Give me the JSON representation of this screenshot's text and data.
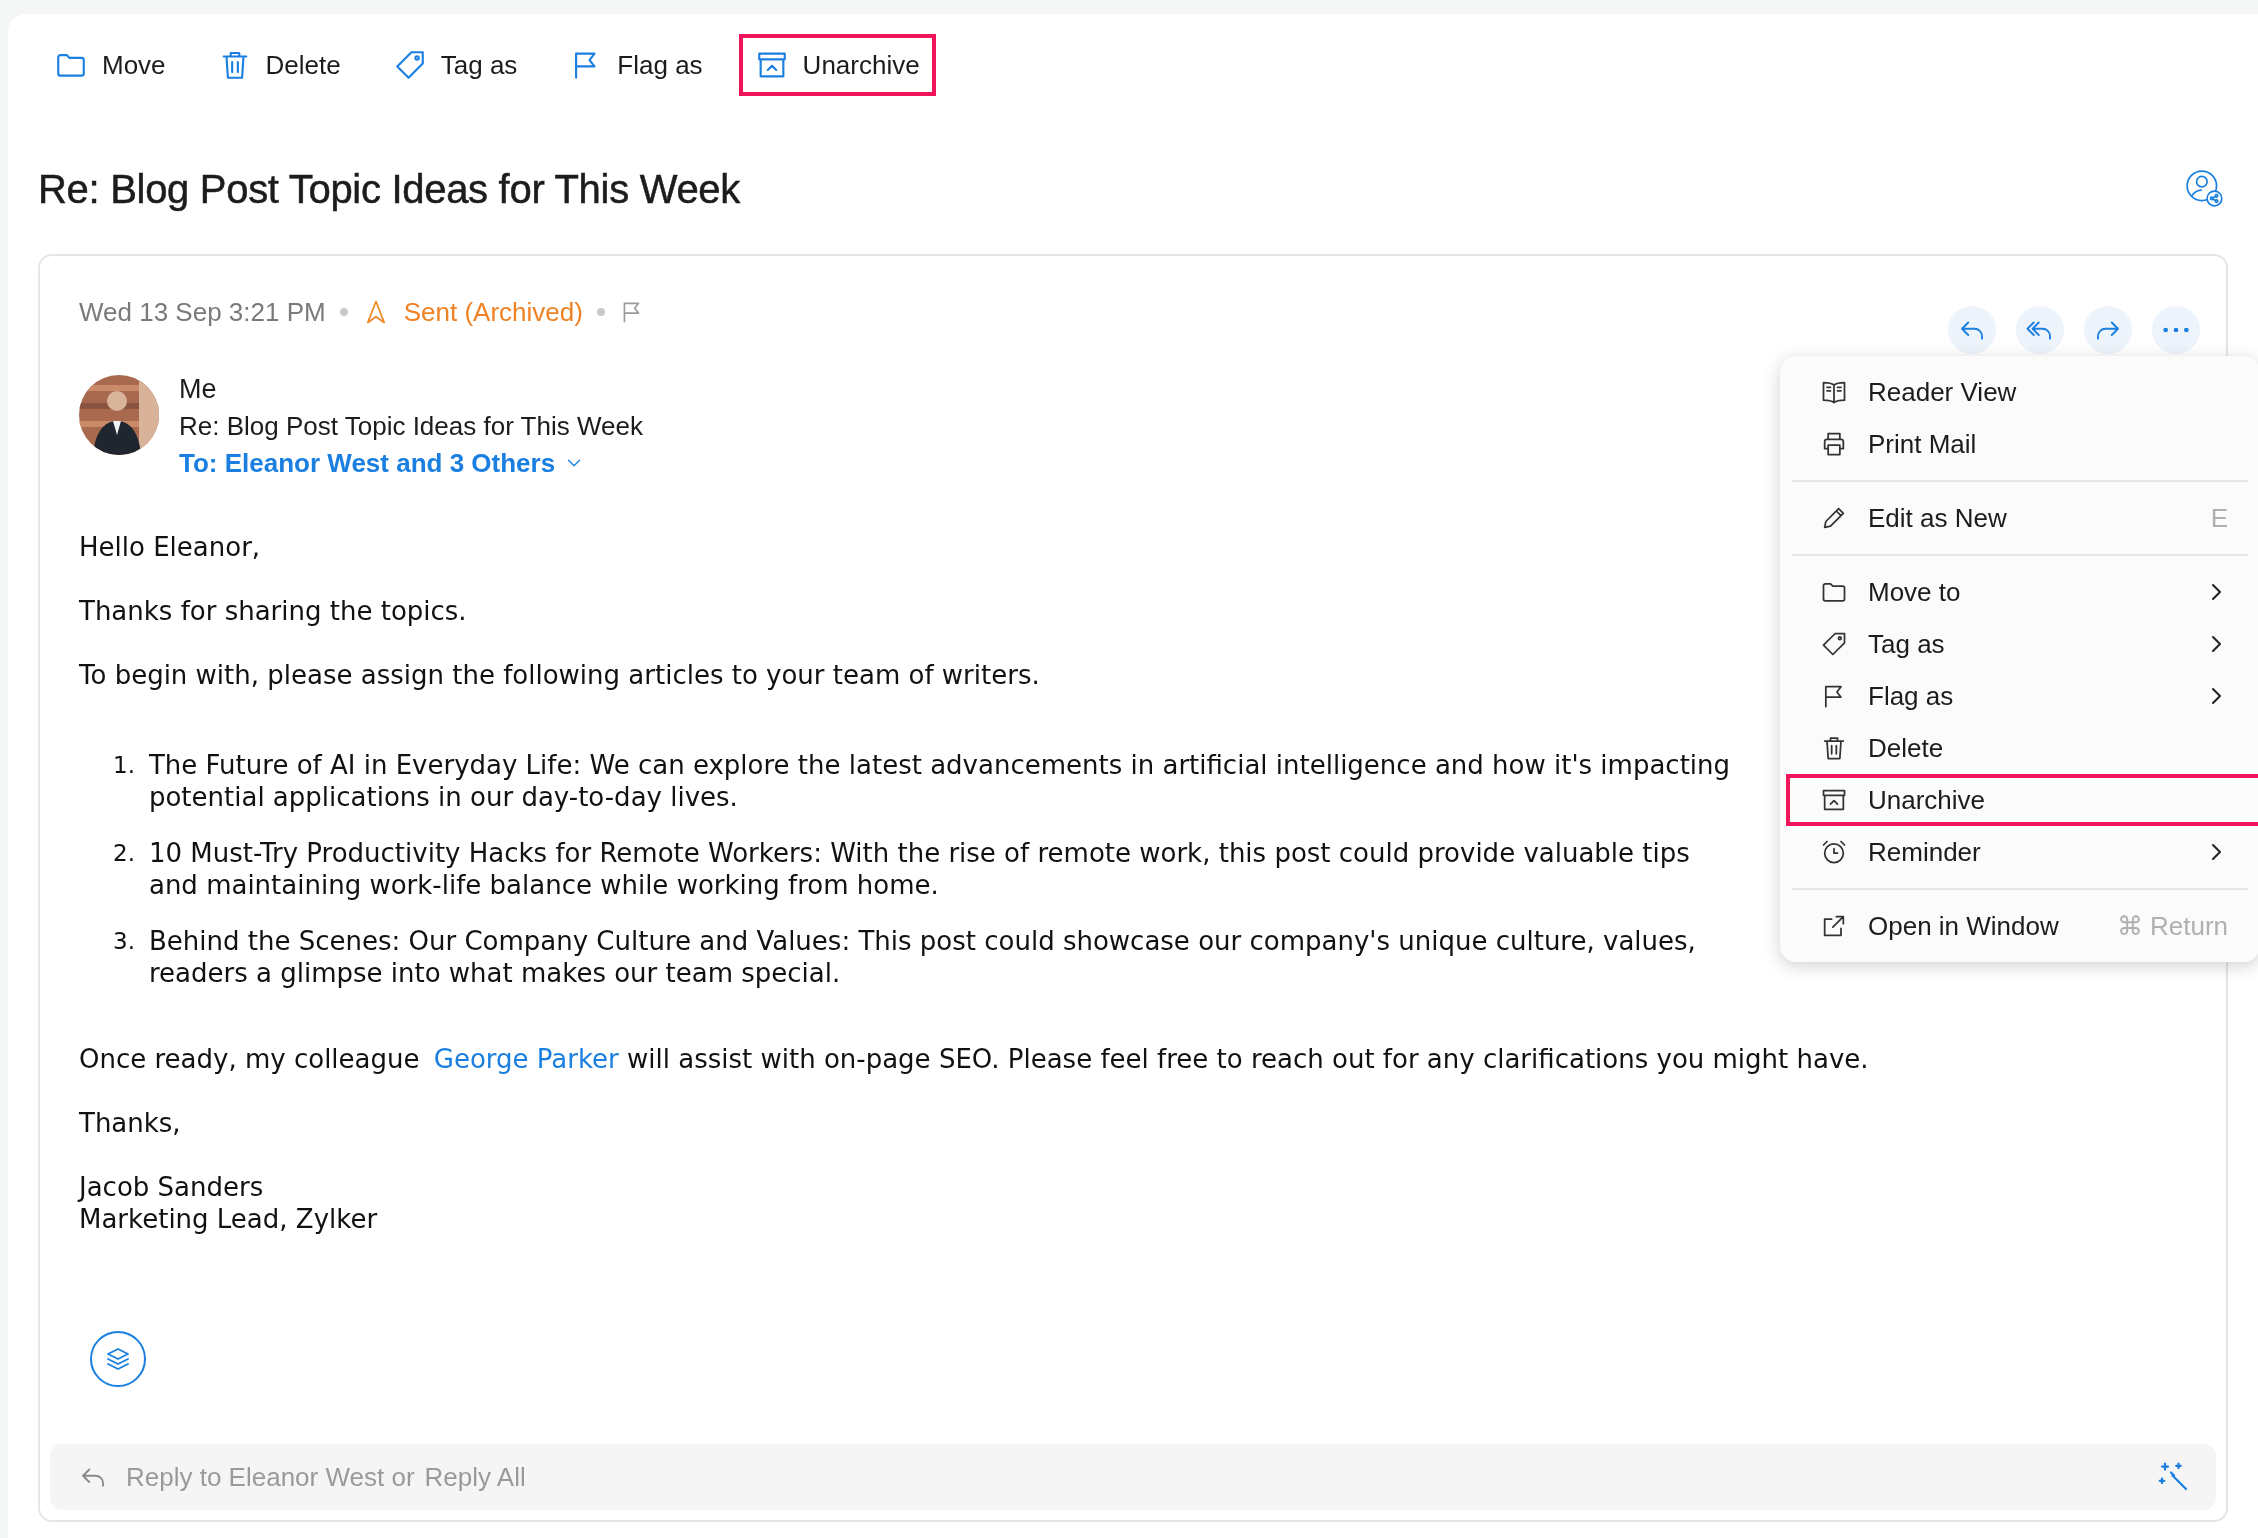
{
  "toolbar": [
    {
      "label": "Move",
      "kind": "folder",
      "highlighted": false
    },
    {
      "label": "Delete",
      "kind": "trash",
      "highlighted": false
    },
    {
      "label": "Tag as",
      "kind": "tag",
      "highlighted": false
    },
    {
      "label": "Flag as",
      "kind": "flag",
      "highlighted": false
    },
    {
      "label": "Unarchive",
      "kind": "archive",
      "highlighted": true
    }
  ],
  "subject": "Re: Blog Post Topic Ideas for This Week",
  "message": {
    "date": "Wed 13 Sep 3:21 PM",
    "status": "Sent (Archived)",
    "flagged": false,
    "sender": "Me",
    "subject": "Re: Blog Post Topic Ideas for This Week",
    "recipients": "To: Eleanor West and 3 Others",
    "body": [
      {
        "kind": "text",
        "lines": [
          "Hello Eleanor,"
        ]
      },
      {
        "kind": "text",
        "lines": [
          "Thanks for sharing the topics."
        ]
      },
      {
        "kind": "text",
        "lines": [
          "To begin with, please assign the following articles to your team of writers."
        ]
      },
      {
        "kind": "list",
        "items": [
          {
            "number": "1.",
            "lines": [
              "The Future of AI in Everyday Life: We can explore the latest advancements in artificial intelligence and how it's impacting",
              "potential applications in our day-to-day lives."
            ]
          },
          {
            "number": "2.",
            "lines": [
              "10 Must-Try Productivity Hacks for Remote Workers: With the rise of remote work, this post could provide valuable tips",
              "and maintaining work-life balance while working from home."
            ]
          },
          {
            "number": "3.",
            "lines": [
              "Behind the Scenes: Our Company Culture and Values: This post could showcase our company's unique culture, values,",
              "readers a glimpse into what makes our team special."
            ]
          }
        ]
      },
      {
        "kind": "mixed",
        "parts": [
          {
            "kind": "plain",
            "text": "Once ready, my colleague "
          },
          {
            "kind": "link",
            "text": "George Parker"
          },
          {
            "kind": "plain",
            "text": " will assist with on-page SEO. Please feel free to reach out for any clarifications you might have."
          }
        ]
      },
      {
        "kind": "text",
        "lines": [
          "Thanks,"
        ]
      },
      {
        "kind": "text",
        "lines": [
          "Jacob Sanders",
          "Marketing Lead, Zylker"
        ]
      }
    ],
    "reply_bar": {
      "reply": "Reply to Eleanor West or",
      "reply_all": "Reply All"
    }
  },
  "menu": {
    "groups": [
      [
        {
          "label": "Reader View",
          "kind": "book",
          "submenu": false,
          "highlighted": false
        },
        {
          "label": "Print Mail",
          "kind": "printer",
          "submenu": false,
          "highlighted": false
        }
      ],
      [
        {
          "label": "Edit as New",
          "kind": "pencil",
          "shortcut": "E",
          "submenu": false,
          "highlighted": false
        }
      ],
      [
        {
          "label": "Move to",
          "kind": "folder",
          "submenu": true,
          "highlighted": false
        },
        {
          "label": "Tag as",
          "kind": "tag",
          "submenu": true,
          "highlighted": false
        },
        {
          "label": "Flag as",
          "kind": "flag",
          "submenu": true,
          "highlighted": false
        },
        {
          "label": "Delete",
          "kind": "trash",
          "submenu": false,
          "highlighted": false
        },
        {
          "label": "Unarchive",
          "kind": "archive",
          "submenu": false,
          "highlighted": true
        },
        {
          "label": "Reminder",
          "kind": "alarm",
          "submenu": true,
          "highlighted": false
        }
      ],
      [
        {
          "label": "Open in Window",
          "kind": "external",
          "shortcut": "⌘ Return",
          "submenu": false,
          "highlighted": false
        }
      ]
    ]
  }
}
